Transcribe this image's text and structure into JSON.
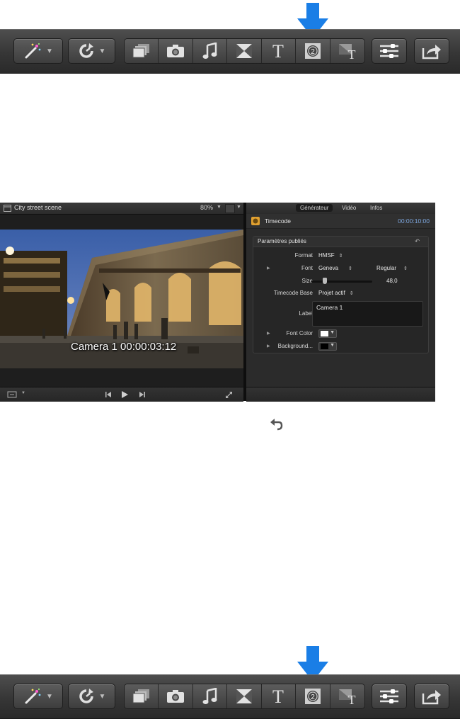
{
  "toolbar": {
    "buttons": [
      {
        "name": "enhancements-button",
        "icon": "magic-wand-icon",
        "has_menu": true
      },
      {
        "name": "retiming-button",
        "icon": "retime-icon",
        "has_menu": true
      },
      {
        "name": "media-browser-button",
        "icon": "photos-icon"
      },
      {
        "name": "photo-browser-button",
        "icon": "camera-icon"
      },
      {
        "name": "music-browser-button",
        "icon": "music-note-icon"
      },
      {
        "name": "transitions-browser-button",
        "icon": "transitions-icon"
      },
      {
        "name": "titles-browser-button",
        "icon": "titles-t-icon"
      },
      {
        "name": "generators-browser-button",
        "icon": "generators-icon"
      },
      {
        "name": "themes-browser-button",
        "icon": "themes-icon"
      },
      {
        "name": "inspector-button",
        "icon": "sliders-icon"
      },
      {
        "name": "share-button",
        "icon": "share-icon"
      }
    ],
    "highlight_color": "#1a7ee6",
    "highlighted": "generators-browser-button"
  },
  "viewer": {
    "title": "City street scene",
    "zoom": "80%",
    "timecode_overlay": "Camera 1 00:00:03:12"
  },
  "inspector": {
    "tabs": [
      "Générateur",
      "Vidéo",
      "Infos"
    ],
    "active_tab": "Générateur",
    "header_title": "Timecode",
    "header_time": "00:00:10:00",
    "panel_title": "Paramètres publiés",
    "params": {
      "format_label": "Format",
      "format_value": "HMSF",
      "font_label": "Font",
      "font_value": "Geneva",
      "font_style": "Regular",
      "size_label": "Size",
      "size_value": "48,0",
      "base_label": "Timecode Base",
      "base_value": "Projet actif",
      "label_label": "Label",
      "label_value": "Camera 1",
      "font_color_label": "Font Color",
      "background_label": "Background..."
    },
    "colors": {
      "font_color": "#ffffff",
      "background_color": "#000000",
      "time_color": "#7ea8e0"
    }
  }
}
